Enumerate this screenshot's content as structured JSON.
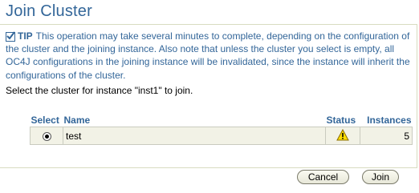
{
  "page": {
    "title": "Join Cluster"
  },
  "tip": {
    "label": "TIP",
    "text": "This operation may take several minutes to complete, depending on the configuration of the cluster and the joining instance. Also note that unless the cluster you select is empty, all OC4J configurations in the joining instance will be invalidated, since the instance will inherit the configurations of the cluster."
  },
  "instruction": "Select the cluster for instance \"inst1\" to join.",
  "table": {
    "headers": {
      "select": "Select",
      "name": "Name",
      "status": "Status",
      "instances": "Instances"
    },
    "rows": [
      {
        "selected": true,
        "name": "test",
        "status_icon": "warning-icon",
        "instances": "5"
      }
    ]
  },
  "buttons": {
    "cancel": "Cancel",
    "join": "Join"
  },
  "colors": {
    "heading": "#336699",
    "row_background": "#f2f2e6",
    "warning": "#ffdd00"
  }
}
